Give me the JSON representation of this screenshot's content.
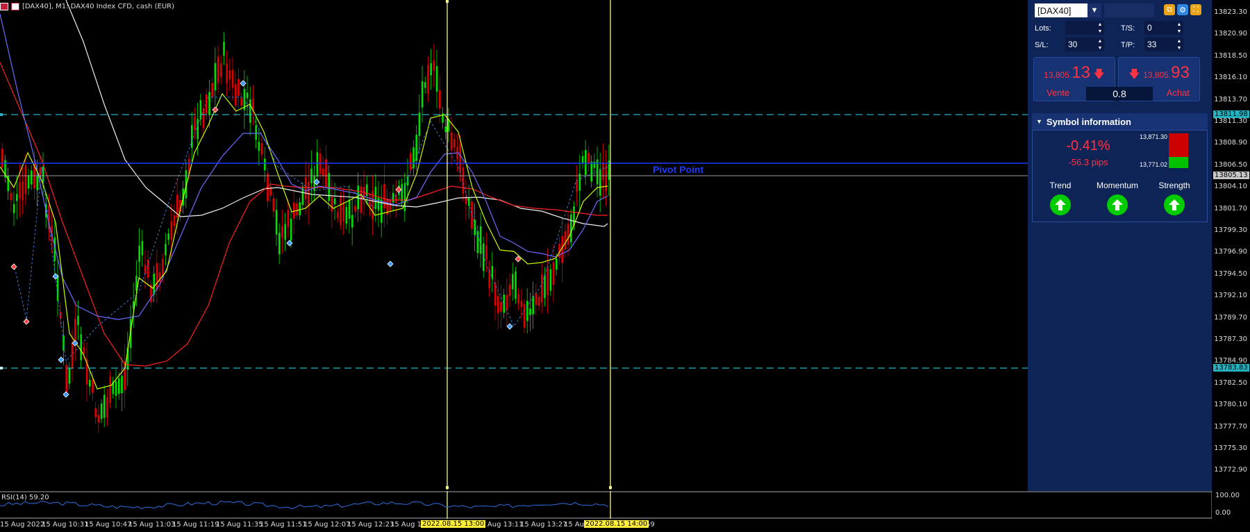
{
  "window": {
    "title": "[DAX40], M1: DAX40 Index CFD, cash (EUR)"
  },
  "chart": {
    "pivot_label": "Pivot Point",
    "resistance_tag": "13811.98",
    "support_tag": "13783.83",
    "current_price_tag": "13805.13",
    "price_axis": [
      "13823.30",
      "13820.90",
      "13818.50",
      "13816.10",
      "13813.70",
      "13811.30",
      "13808.90",
      "13806.50",
      "13804.10",
      "13801.70",
      "13799.30",
      "13796.90",
      "13794.50",
      "13792.10",
      "13789.70",
      "13787.30",
      "13784.90",
      "13782.50",
      "13780.10",
      "13777.70",
      "13775.30",
      "13772.90"
    ],
    "time_axis": [
      "15 Aug 2022",
      "15 Aug 10:31",
      "15 Aug 10:47",
      "15 Aug 11:03",
      "15 Aug 11:19",
      "15 Aug 11:35",
      "15 Aug 11:51",
      "15 Aug 12:07",
      "15 Aug 12:23",
      "15 Aug 12:",
      "15 Aug 13:11",
      "15 Aug 13:27",
      "15 Aug",
      "59"
    ],
    "time_tag_1": "2022.08.15 13:00",
    "time_tag_2": "2022.08.15 14:00",
    "colors": {
      "bull": "#00e000",
      "bear": "#e00000",
      "ma_yellow": "#c8ff00",
      "ma_blue": "#6c6cff",
      "ma_red": "#ff2020",
      "ma_white": "#f0f0f0",
      "cyan": "#25b3c1",
      "pivot": "#1a3cff",
      "vline": "#f7f78a"
    }
  },
  "rsi": {
    "label": "RSI(14) 59.20",
    "axis_top": "100.00",
    "axis_bottom": "0.00"
  },
  "panel": {
    "symbol": "[DAX40]",
    "lots_label": "Lots:",
    "lots_value": "",
    "ts_label": "T/S:",
    "ts_value": "0",
    "sl_label": "S/L:",
    "sl_value": "30",
    "tp_label": "T/P:",
    "tp_value": "33",
    "sell_small": "13,805.",
    "sell_big": "13",
    "sell_label": "Vente",
    "buy_small": "13,805.",
    "buy_big": "93",
    "buy_label": "Achat",
    "spread": "0.8",
    "section_title": "Symbol information",
    "change_pct": "-0.41%",
    "change_pips": "-56.3 pips",
    "high": "13,871.30",
    "low": "13,771.02",
    "trend_label": "Trend",
    "momentum_label": "Momentum",
    "strength_label": "Strength"
  }
}
